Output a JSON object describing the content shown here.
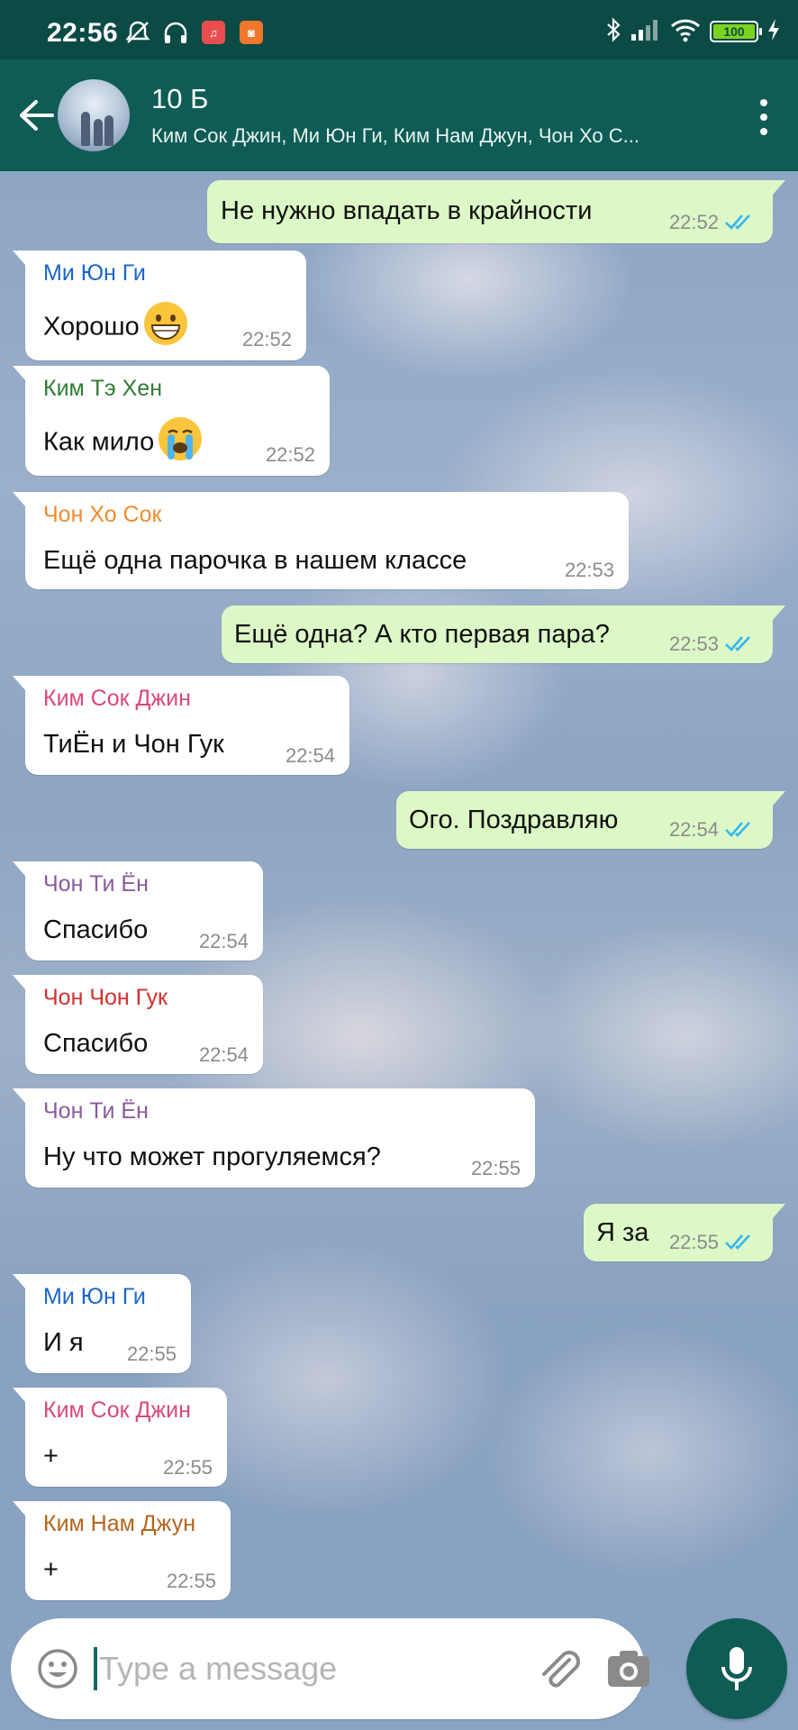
{
  "status_bar": {
    "time": "22:56",
    "battery": "100",
    "icons": [
      "mute-icon",
      "headphones-icon",
      "music-app-icon",
      "mi-app-icon",
      "bluetooth-icon",
      "signal-icon",
      "wifi-icon",
      "battery-icon",
      "charging-icon"
    ]
  },
  "header": {
    "title": "10 Б",
    "members": "Ким Сок Джин, Ми Юн Ги, Ким Нам Джун, Чон Хо С..."
  },
  "messages": [
    {
      "dir": "out",
      "text": "Не нужно впадать в крайности",
      "time": "22:52"
    },
    {
      "dir": "in",
      "sender": "Ми Юн Ги",
      "sender_color": "#1a66c9",
      "text": "Хорошо",
      "emoji": "grin",
      "time": "22:52"
    },
    {
      "dir": "in",
      "sender": "Ким Тэ Хен",
      "sender_color": "#2e7d32",
      "text": "Как мило",
      "emoji": "cry",
      "time": "22:52"
    },
    {
      "dir": "in",
      "sender": "Чон Хо Сок",
      "sender_color": "#ef8a2e",
      "text": "Ещё одна парочка в нашем классе",
      "time": "22:53"
    },
    {
      "dir": "out",
      "text": "Ещё одна? А кто первая пара?",
      "time": "22:53"
    },
    {
      "dir": "in",
      "sender": "Ким Сок Джин",
      "sender_color": "#d9487d",
      "text": "ТиЁн и Чон Гук",
      "time": "22:54"
    },
    {
      "dir": "out",
      "text": "Ого. Поздравляю",
      "time": "22:54"
    },
    {
      "dir": "in",
      "sender": "Чон Ти Ён",
      "sender_color": "#8a5a9e",
      "text": "Спасибо",
      "time": "22:54"
    },
    {
      "dir": "in",
      "sender": "Чон Чон Гук",
      "sender_color": "#d32f2f",
      "text": "Спасибо",
      "time": "22:54"
    },
    {
      "dir": "in",
      "sender": "Чон Ти Ён",
      "sender_color": "#8a5a9e",
      "text": "Ну что может прогуляемся?",
      "time": "22:55"
    },
    {
      "dir": "out",
      "text": "Я за",
      "time": "22:55"
    },
    {
      "dir": "in",
      "sender": "Ми Юн Ги",
      "sender_color": "#1a66c9",
      "text": "И я",
      "time": "22:55"
    },
    {
      "dir": "in",
      "sender": "Ким Сок Джин",
      "sender_color": "#d9487d",
      "text": "+",
      "time": "22:55"
    },
    {
      "dir": "in",
      "sender": "Ким Нам Джун",
      "sender_color": "#b5651d",
      "text": "+",
      "time": "22:55"
    }
  ],
  "composer": {
    "placeholder": "Type a message"
  },
  "colors": {
    "header_bg": "#0e5c55",
    "status_bg": "#0b4a45",
    "outgoing_bubble": "#dcf8c6",
    "incoming_bubble": "#ffffff",
    "read_ticks": "#34b7f1"
  }
}
